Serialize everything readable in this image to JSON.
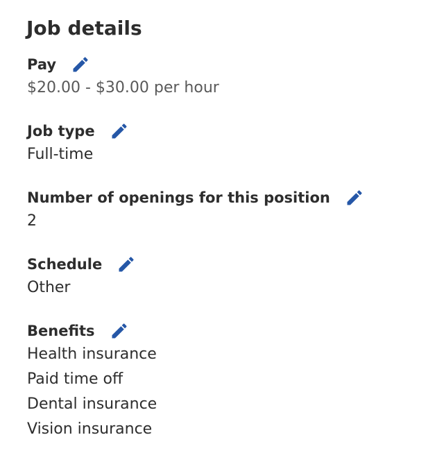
{
  "page_title": "Job details",
  "accent_color": "#2557a7",
  "sections": {
    "pay": {
      "label": "Pay",
      "value": "$20.00 - $30.00 per hour",
      "edit_icon": "pencil-icon"
    },
    "job_type": {
      "label": "Job type",
      "value": "Full-time",
      "edit_icon": "pencil-icon"
    },
    "openings": {
      "label": "Number of openings for this position",
      "value": "2",
      "edit_icon": "pencil-icon"
    },
    "schedule": {
      "label": "Schedule",
      "value": "Other",
      "edit_icon": "pencil-icon"
    },
    "benefits": {
      "label": "Benefits",
      "edit_icon": "pencil-icon",
      "items": [
        "Health insurance",
        "Paid time off",
        "Dental insurance",
        "Vision insurance"
      ]
    }
  }
}
